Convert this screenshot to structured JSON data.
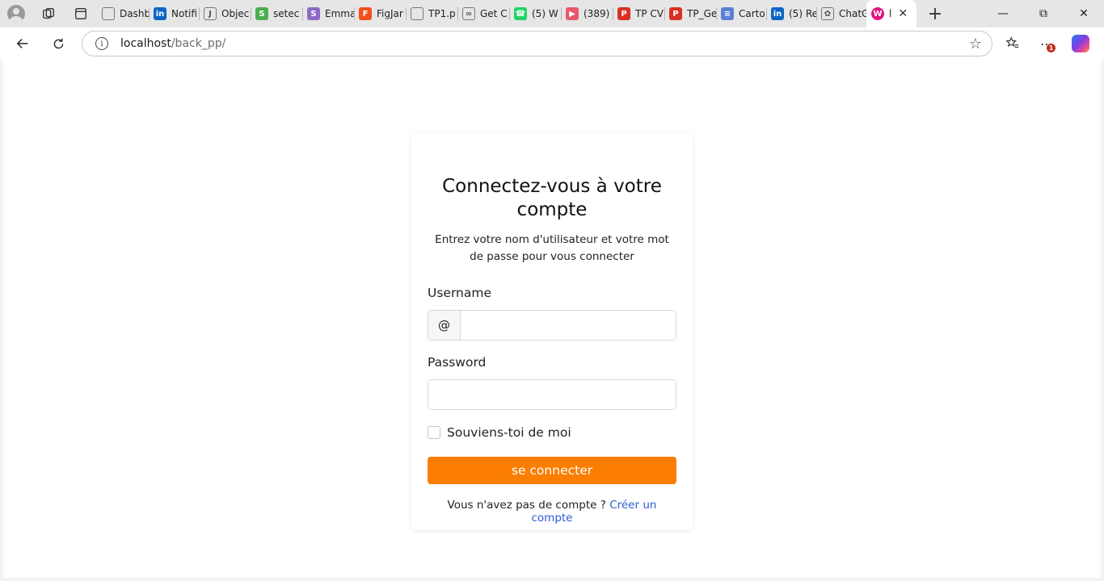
{
  "tabs": [
    {
      "title": "Dashb",
      "icon": "page-icon",
      "color": "#ffffff"
    },
    {
      "title": "Notifi",
      "icon": "linkedin-icon",
      "color": "#0a66c2"
    },
    {
      "title": "Objec",
      "icon": "j-icon",
      "color": "#ffffff"
    },
    {
      "title": "setec",
      "icon": "swirl-icon",
      "color": "#4caf50"
    },
    {
      "title": "Emma",
      "icon": "s-icon",
      "color": "#8e6ac8"
    },
    {
      "title": "FigJar",
      "icon": "figma-icon",
      "color": "#f24e1e"
    },
    {
      "title": "TP1.p",
      "icon": "page-icon",
      "color": "#ffffff"
    },
    {
      "title": "Get C",
      "icon": "link-icon",
      "color": "#ffffff"
    },
    {
      "title": "(5) W",
      "icon": "whatsapp-icon",
      "color": "#25d366"
    },
    {
      "title": "(389)",
      "icon": "youtube-icon",
      "color": "#e8576a"
    },
    {
      "title": "TP CV",
      "icon": "pdf-icon",
      "color": "#d93025"
    },
    {
      "title": "TP_Ge",
      "icon": "pdf-icon",
      "color": "#d93025"
    },
    {
      "title": "Carto",
      "icon": "forms-icon",
      "color": "#5b7fd6"
    },
    {
      "title": "(5) Re",
      "icon": "linkedin-icon",
      "color": "#0a66c2"
    },
    {
      "title": "ChatG",
      "icon": "chatgpt-icon",
      "color": "#ffffff"
    }
  ],
  "active_tab": {
    "title": "l",
    "icon": "wamp-icon",
    "color": "#e4147f"
  },
  "address_bar": {
    "host": "localhost",
    "path": "/back_pp/"
  },
  "menu_badge": "1",
  "login": {
    "title": "Connectez-vous à votre compte",
    "subtitle": "Entrez votre nom d'utilisateur et votre mot de passe pour vous connecter",
    "username_label": "Username",
    "username_prefix": "@",
    "username_value": "",
    "password_label": "Password",
    "password_value": "",
    "remember_label": "Souviens-toi de moi",
    "submit_label": "se connecter",
    "no_account_text": "Vous n'avez pas de compte ?",
    "create_account_link": "Créer un compte"
  },
  "colors": {
    "accent": "#fb7e00",
    "link": "#2b5bd7"
  }
}
